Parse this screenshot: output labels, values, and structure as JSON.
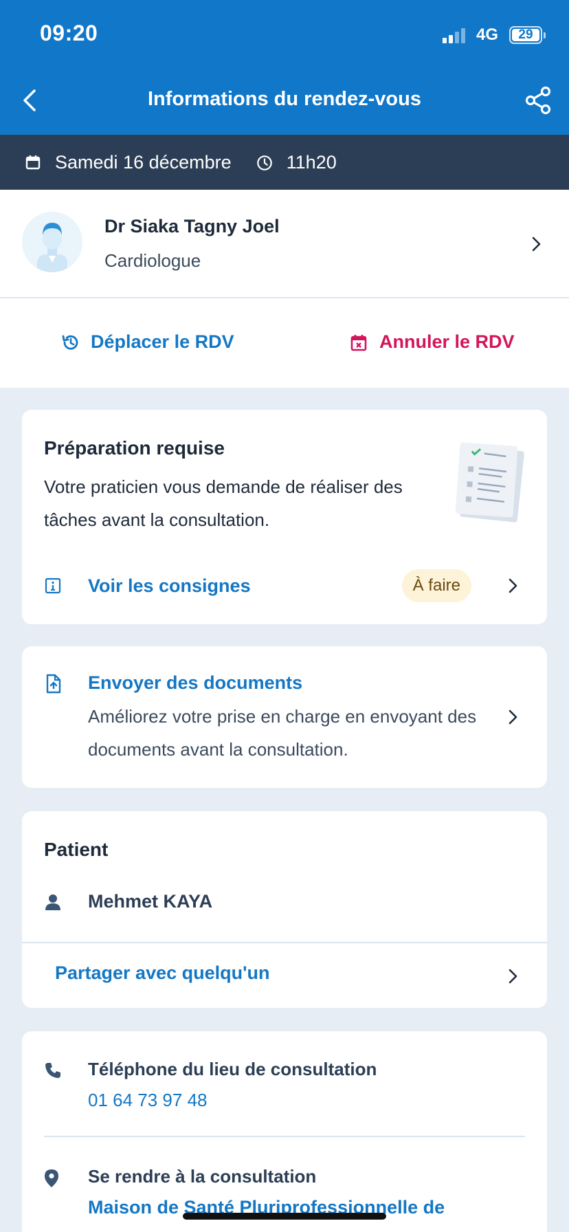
{
  "status_bar": {
    "time": "09:20",
    "network": "4G",
    "battery": "29"
  },
  "nav": {
    "title": "Informations du rendez-vous"
  },
  "appointment": {
    "date": "Samedi 16 décembre",
    "time": "11h20"
  },
  "doctor": {
    "name": "Dr Siaka Tagny Joel",
    "specialty": "Cardiologue"
  },
  "actions": {
    "move_label": "Déplacer le RDV",
    "cancel_label": "Annuler le RDV"
  },
  "preparation": {
    "title": "Préparation requise",
    "text": "Votre praticien vous demande de réaliser des tâches avant la consultation.",
    "link_label": "Voir les consignes",
    "badge": "À faire"
  },
  "documents": {
    "title": "Envoyer des documents",
    "text": "Améliorez votre prise en charge en envoyant des documents avant la consultation."
  },
  "patient": {
    "section_title": "Patient",
    "name": "Mehmet KAYA",
    "share_label": "Partager avec quelqu'un"
  },
  "contact": {
    "phone_label": "Téléphone du lieu de consultation",
    "phone_value": "01 64 73 97 48",
    "directions_label": "Se rendre à la consultation",
    "place_name": "Maison de Santé Pluriprofessionnelle de"
  },
  "colors": {
    "primary": "#1177c9",
    "link": "#1477c4",
    "danger": "#d4145a",
    "date_bar": "#2c3e55",
    "background": "#e6edf5",
    "badge_bg": "#fdf3d8"
  },
  "icons": {
    "back": "chevron-left-icon",
    "share": "share-icon",
    "calendar": "calendar-icon",
    "clock": "clock-icon",
    "history": "history-icon",
    "cancel": "calendar-x-icon",
    "info": "info-icon",
    "upload": "file-upload-icon",
    "user": "user-icon",
    "phone": "phone-icon",
    "location": "location-pin-icon"
  }
}
